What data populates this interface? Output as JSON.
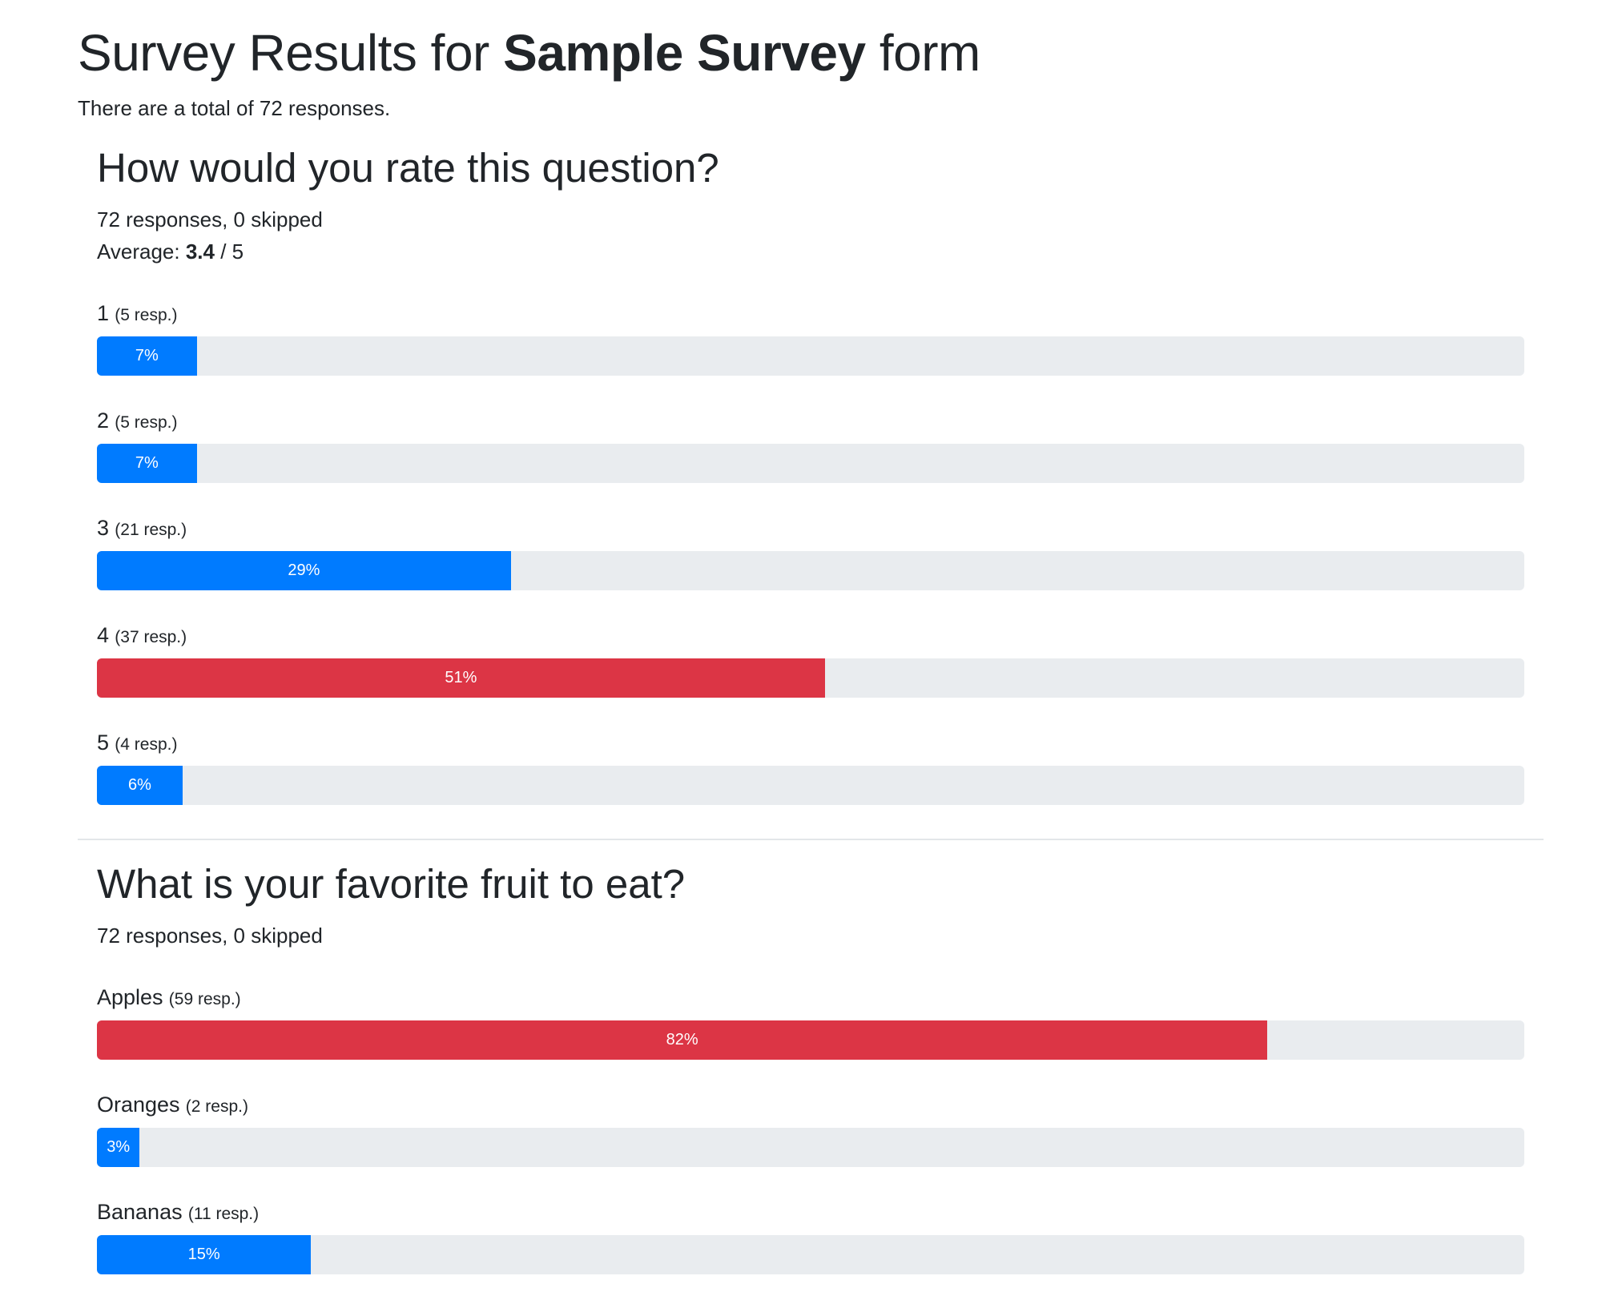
{
  "page": {
    "title_prefix": "Survey Results for ",
    "form_name": "Sample Survey",
    "title_suffix": " form",
    "total_text": "There are a total of 72 responses."
  },
  "colors": {
    "normal": "#007bff",
    "highlight": "#dc3545",
    "track": "#e9ecef"
  },
  "questions": [
    {
      "title": "How would you rate this question?",
      "responses_text": "72 responses, 0 skipped",
      "average_prefix": "Average: ",
      "average_value": "3.4",
      "average_suffix": " / 5",
      "options": [
        {
          "name": "1",
          "count_text": "(5 resp.)",
          "percent_text": "7%",
          "percent": 7,
          "highlight": false
        },
        {
          "name": "2",
          "count_text": "(5 resp.)",
          "percent_text": "7%",
          "percent": 7,
          "highlight": false
        },
        {
          "name": "3",
          "count_text": "(21 resp.)",
          "percent_text": "29%",
          "percent": 29,
          "highlight": false
        },
        {
          "name": "4",
          "count_text": "(37 resp.)",
          "percent_text": "51%",
          "percent": 51,
          "highlight": true
        },
        {
          "name": "5",
          "count_text": "(4 resp.)",
          "percent_text": "6%",
          "percent": 6,
          "highlight": false
        }
      ]
    },
    {
      "title": "What is your favorite fruit to eat?",
      "responses_text": "72 responses, 0 skipped",
      "options": [
        {
          "name": "Apples",
          "count_text": "(59 resp.)",
          "percent_text": "82%",
          "percent": 82,
          "highlight": true
        },
        {
          "name": "Oranges",
          "count_text": "(2 resp.)",
          "percent_text": "3%",
          "percent": 3,
          "highlight": false
        },
        {
          "name": "Bananas",
          "count_text": "(11 resp.)",
          "percent_text": "15%",
          "percent": 15,
          "highlight": false
        }
      ]
    }
  ]
}
